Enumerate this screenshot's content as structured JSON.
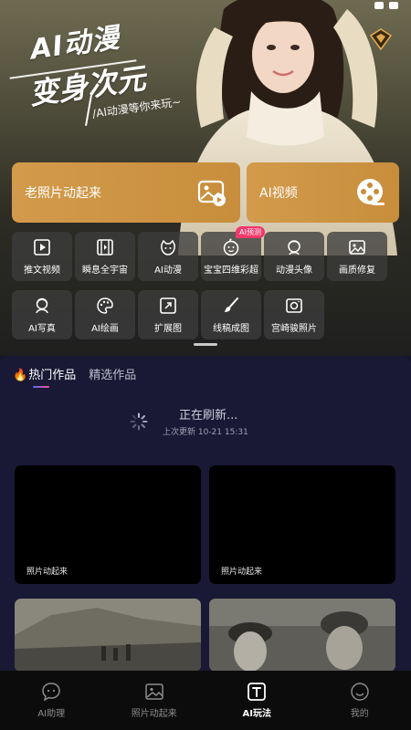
{
  "hero": {
    "title_line1": "AI动漫",
    "title_line2": "变身次元",
    "subtitle": "/AI动漫等你来玩~"
  },
  "big_cards": [
    {
      "label": "老照片动起来",
      "icon": "photo-play-icon"
    },
    {
      "label": "AI视频",
      "icon": "film-reel-icon"
    }
  ],
  "tools_row1": [
    {
      "label": "推文视频",
      "icon": "video-play-icon"
    },
    {
      "label": "瞬息全宇宙",
      "icon": "film-strip-icon"
    },
    {
      "label": "AI动漫",
      "icon": "anime-face-icon"
    },
    {
      "label": "宝宝四维彩超",
      "icon": "baby-face-icon",
      "badge": "AI预测"
    },
    {
      "label": "动漫头像",
      "icon": "avatar-icon"
    },
    {
      "label": "画质修复",
      "icon": "image-icon"
    }
  ],
  "tools_row2": [
    {
      "label": "AI写真",
      "icon": "portrait-icon"
    },
    {
      "label": "AI绘画",
      "icon": "palette-icon"
    },
    {
      "label": "扩展图",
      "icon": "expand-icon"
    },
    {
      "label": "线稿成图",
      "icon": "brush-icon"
    },
    {
      "label": "宫崎骏照片",
      "icon": "camera-frame-icon"
    }
  ],
  "content": {
    "tabs": [
      {
        "label": "热门作品",
        "active": true
      },
      {
        "label": "精选作品",
        "active": false
      }
    ],
    "refresh_text": "正在刷新...",
    "last_update": "上次更新 10-21 15:31",
    "works": [
      {
        "label": "照片动起来"
      },
      {
        "label": "照片动起来"
      }
    ]
  },
  "nav": [
    {
      "label": "AI助理",
      "icon": "chat-bubble-icon",
      "active": false
    },
    {
      "label": "照片动起来",
      "icon": "photo-icon",
      "active": false
    },
    {
      "label": "AI玩法",
      "icon": "text-t-icon",
      "active": true
    },
    {
      "label": "我的",
      "icon": "smile-face-icon",
      "active": false
    }
  ],
  "colors": {
    "accent_gold": "#d29a4a",
    "panel_bg": "#191935",
    "badge_pink": "#f0386b",
    "nav_bg": "#0c0c0c"
  }
}
